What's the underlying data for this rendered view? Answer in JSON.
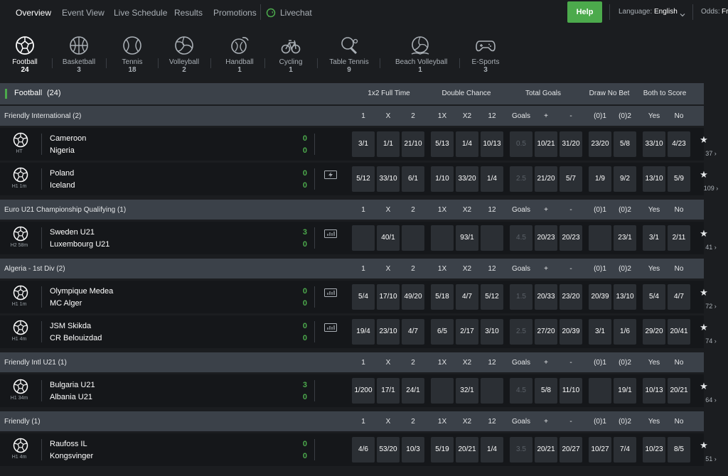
{
  "nav": {
    "items": [
      "Overview",
      "Event View",
      "Live Schedule",
      "Results",
      "Promotions",
      "Livechat"
    ],
    "help": "Help",
    "language_label": "Language:",
    "language_value": "English",
    "odds_label": "Odds:",
    "odds_value": "Fr"
  },
  "sports": [
    {
      "name": "Football",
      "count": "24",
      "icon": "football-icon"
    },
    {
      "name": "Basketball",
      "count": "3",
      "icon": "basketball-icon"
    },
    {
      "name": "Tennis",
      "count": "18",
      "icon": "tennis-icon"
    },
    {
      "name": "Volleyball",
      "count": "2",
      "icon": "volleyball-icon"
    },
    {
      "name": "Handball",
      "count": "1",
      "icon": "handball-icon"
    },
    {
      "name": "Cycling",
      "count": "1",
      "icon": "cycling-icon"
    },
    {
      "name": "Table Tennis",
      "count": "9",
      "icon": "table-tennis-icon"
    },
    {
      "name": "Beach Volleyball",
      "count": "1",
      "icon": "beach-volleyball-icon"
    },
    {
      "name": "E-Sports",
      "count": "3",
      "icon": "esports-icon"
    }
  ],
  "section": {
    "title": "Football",
    "count": "(24)",
    "groups": [
      "1x2 Full Time",
      "Double Chance",
      "Total Goals",
      "Draw No Bet",
      "Both to Score"
    ]
  },
  "columns": [
    "1",
    "X",
    "2",
    "1X",
    "X2",
    "12",
    "Goals",
    "+",
    "-",
    "(0)1",
    "(0)2",
    "Yes",
    "No"
  ],
  "leagues": [
    {
      "name": "Friendly International (2)",
      "matches": [
        {
          "status": "HT",
          "home": "Cameroon",
          "away": "Nigeria",
          "home_score": "0",
          "away_score": "0",
          "media": "",
          "odds": [
            "3/1",
            "1/1",
            "21/10",
            "5/13",
            "1/4",
            "10/13",
            "0.5",
            "10/21",
            "31/20",
            "23/20",
            "5/8",
            "33/10",
            "4/23"
          ],
          "more": "37"
        },
        {
          "status": "H1 1m",
          "home": "Poland",
          "away": "Iceland",
          "home_score": "0",
          "away_score": "0",
          "media": "live-stream-icon",
          "odds": [
            "5/12",
            "33/10",
            "6/1",
            "1/10",
            "33/20",
            "1/4",
            "2.5",
            "21/20",
            "5/7",
            "1/9",
            "9/2",
            "13/10",
            "5/9"
          ],
          "more": "109"
        }
      ]
    },
    {
      "name": "Euro U21 Championship Qualifying (1)",
      "matches": [
        {
          "status": "H2 58m",
          "home": "Sweden U21",
          "away": "Luxembourg U21",
          "home_score": "3",
          "away_score": "0",
          "media": "stats-icon",
          "odds": [
            "",
            "40/1",
            "",
            "",
            "93/1",
            "",
            "4.5",
            "20/23",
            "20/23",
            "",
            "23/1",
            "3/1",
            "2/11"
          ],
          "more": "41"
        }
      ]
    },
    {
      "name": "Algeria - 1st Div (2)",
      "matches": [
        {
          "status": "H1 1m",
          "home": "Olympique Medea",
          "away": "MC Alger",
          "home_score": "0",
          "away_score": "0",
          "media": "stats-icon",
          "odds": [
            "5/4",
            "17/10",
            "49/20",
            "5/18",
            "4/7",
            "5/12",
            "1.5",
            "20/33",
            "23/20",
            "20/39",
            "13/10",
            "5/4",
            "4/7"
          ],
          "more": "72"
        },
        {
          "status": "H1 4m",
          "home": "JSM Skikda",
          "away": "CR Belouizdad",
          "home_score": "0",
          "away_score": "0",
          "media": "stats-icon",
          "odds": [
            "19/4",
            "23/10",
            "4/7",
            "6/5",
            "2/17",
            "3/10",
            "2.5",
            "27/20",
            "20/39",
            "3/1",
            "1/6",
            "29/20",
            "20/41"
          ],
          "more": "74"
        }
      ]
    },
    {
      "name": "Friendly Intl U21 (1)",
      "matches": [
        {
          "status": "H1 34m",
          "home": "Bulgaria U21",
          "away": "Albania U21",
          "home_score": "3",
          "away_score": "0",
          "media": "",
          "odds": [
            "1/200",
            "17/1",
            "24/1",
            "",
            "32/1",
            "",
            "4.5",
            "5/8",
            "11/10",
            "",
            "19/1",
            "10/13",
            "20/21"
          ],
          "more": "64"
        }
      ]
    },
    {
      "name": "Friendly (1)",
      "matches": [
        {
          "status": "H1 4m",
          "home": "Raufoss IL",
          "away": "Kongsvinger",
          "home_score": "0",
          "away_score": "0",
          "media": "",
          "odds": [
            "4/6",
            "53/20",
            "10/3",
            "5/19",
            "20/21",
            "1/4",
            "3.5",
            "20/21",
            "20/27",
            "10/27",
            "7/4",
            "10/23",
            "8/5"
          ],
          "more": "51"
        }
      ]
    }
  ]
}
